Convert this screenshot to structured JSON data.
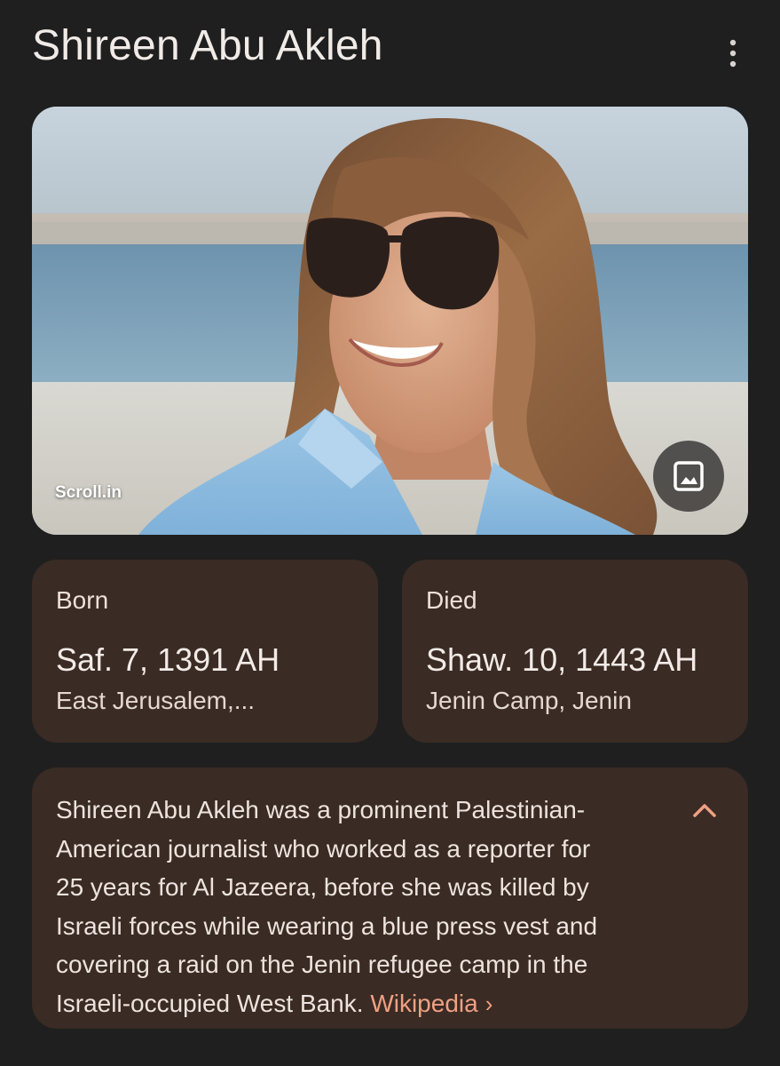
{
  "header": {
    "title": "Shireen Abu Akleh",
    "more_icon": "more-vert-icon"
  },
  "hero": {
    "source": "Scroll.in",
    "image_icon": "image-icon"
  },
  "facts": {
    "born": {
      "label": "Born",
      "value": "Saf. 7, 1391 AH",
      "place": "East Jerusalem,..."
    },
    "died": {
      "label": "Died",
      "value": "Shaw. 10, 1443 AH",
      "place": "Jenin Camp, Jenin"
    }
  },
  "description": {
    "lines": [
      "Shireen Abu Akleh was a prominent Palestinian-",
      "American journalist who worked as a reporter for",
      "25 years for Al Jazeera, before she was killed by",
      "Israeli forces while wearing a blue press vest and",
      "covering a raid on the Jenin refugee camp in the",
      "Israeli-occupied West Bank."
    ],
    "source_link": "Wikipedia",
    "link_chevron": "›",
    "collapse_icon": "chevron-up-icon"
  },
  "colors": {
    "background": "#1f1f1f",
    "card": "#3a2b24",
    "link": "#f0a083"
  }
}
